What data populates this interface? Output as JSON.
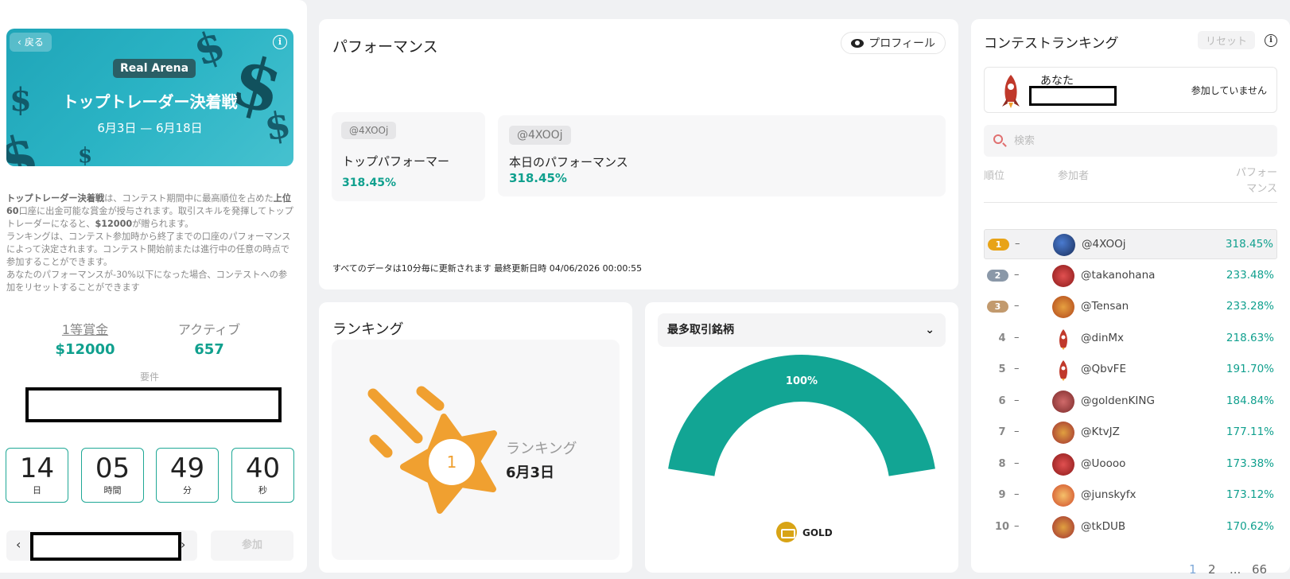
{
  "hero": {
    "back_label": "戻る",
    "badge": "Real Arena",
    "title": "トップトレーダー決着戦",
    "dates": "6月3日 — 6月18日"
  },
  "description": {
    "p1_b1": "トップトレーダー決着戦",
    "p1_t1": "は、コンテスト期間中に最高順位を占めた",
    "p1_b2": "上位60",
    "p1_t2": "口座に出金可能な賞金が授与されます。取引スキルを発揮してトップトレーダーになると、",
    "p1_b3": "$12000",
    "p1_t3": "が贈られます。",
    "p2": "ランキングは、コンテスト参加時から終了までの口座のパフォーマンスによって決定されます。コンテスト開始前または進行中の任意の時点で参加することができます。",
    "p3": "あなたのパフォーマンスが-30%以下になった場合、コンテストへの参加をリセットすることができます"
  },
  "stats": {
    "prize_label": "1等賞金",
    "prize_value": "$12000",
    "active_label": "アクティブ",
    "active_value": "657",
    "requirements_label": "要件"
  },
  "countdown": [
    {
      "value": "14",
      "unit": "日"
    },
    {
      "value": "05",
      "unit": "時間"
    },
    {
      "value": "49",
      "unit": "分"
    },
    {
      "value": "40",
      "unit": "秒"
    }
  ],
  "join_label": "参加",
  "performance": {
    "title": "パフォーマンス",
    "profile_label": "プロフィール",
    "card1": {
      "tag": "@4XOOj",
      "label": "トップパフォーマー",
      "value": "318.45%"
    },
    "card2": {
      "tag": "@4XOOj",
      "label": "本日のパフォーマンス",
      "value": "318.45%"
    },
    "update_note": "すべてのデータは10分毎に更新されます 最終更新日時 04/06/2026 00:00:55"
  },
  "ranking_panel": {
    "title": "ランキング",
    "rank_number": "1",
    "sub_label": "ランキング",
    "date": "6月3日"
  },
  "symbols": {
    "dropdown_label": "最多取引銘柄",
    "gauge_percent": 100,
    "gauge_label": "100%",
    "symbol_name": "GOLD",
    "color": "#12a594"
  },
  "contest": {
    "title": "コンテストランキング",
    "reset_label": "リセット",
    "you_label": "あなた",
    "you_status": "参加していません",
    "search_placeholder": "検索",
    "col_rank": "順位",
    "col_participant": "参加者",
    "col_perf_1": "パフォー",
    "col_perf_2": "マンス",
    "rows": [
      {
        "rank": "1",
        "change": "–",
        "name": "@4XOOj",
        "perf": "318.45%",
        "avatar": "planet"
      },
      {
        "rank": "2",
        "change": "–",
        "name": "@takanohana",
        "perf": "233.48%",
        "avatar": "diamond"
      },
      {
        "rank": "3",
        "change": "–",
        "name": "@Tensan",
        "perf": "233.28%",
        "avatar": "dog"
      },
      {
        "rank": "4",
        "change": "–",
        "name": "@dinMx",
        "perf": "218.63%",
        "avatar": "rocket"
      },
      {
        "rank": "5",
        "change": "–",
        "name": "@QbvFE",
        "perf": "191.70%",
        "avatar": "rocket"
      },
      {
        "rank": "6",
        "change": "–",
        "name": "@goldenKING",
        "perf": "184.84%",
        "avatar": "cash"
      },
      {
        "rank": "7",
        "change": "–",
        "name": "@KtvJZ",
        "perf": "177.11%",
        "avatar": "chest"
      },
      {
        "rank": "8",
        "change": "–",
        "name": "@Uoooo",
        "perf": "173.38%",
        "avatar": "diamond"
      },
      {
        "rank": "9",
        "change": "–",
        "name": "@junskyfx",
        "perf": "173.12%",
        "avatar": "person"
      },
      {
        "rank": "10",
        "change": "–",
        "name": "@tkDUB",
        "perf": "170.62%",
        "avatar": "chest"
      }
    ],
    "pages": [
      "1",
      "2",
      "...",
      "66"
    ]
  },
  "colors": {
    "accent": "#10a08e",
    "gold_medal": "#e8a317",
    "silver_medal": "#8a98a8",
    "bronze_medal": "#c29a6e",
    "star": "#f0a030"
  }
}
